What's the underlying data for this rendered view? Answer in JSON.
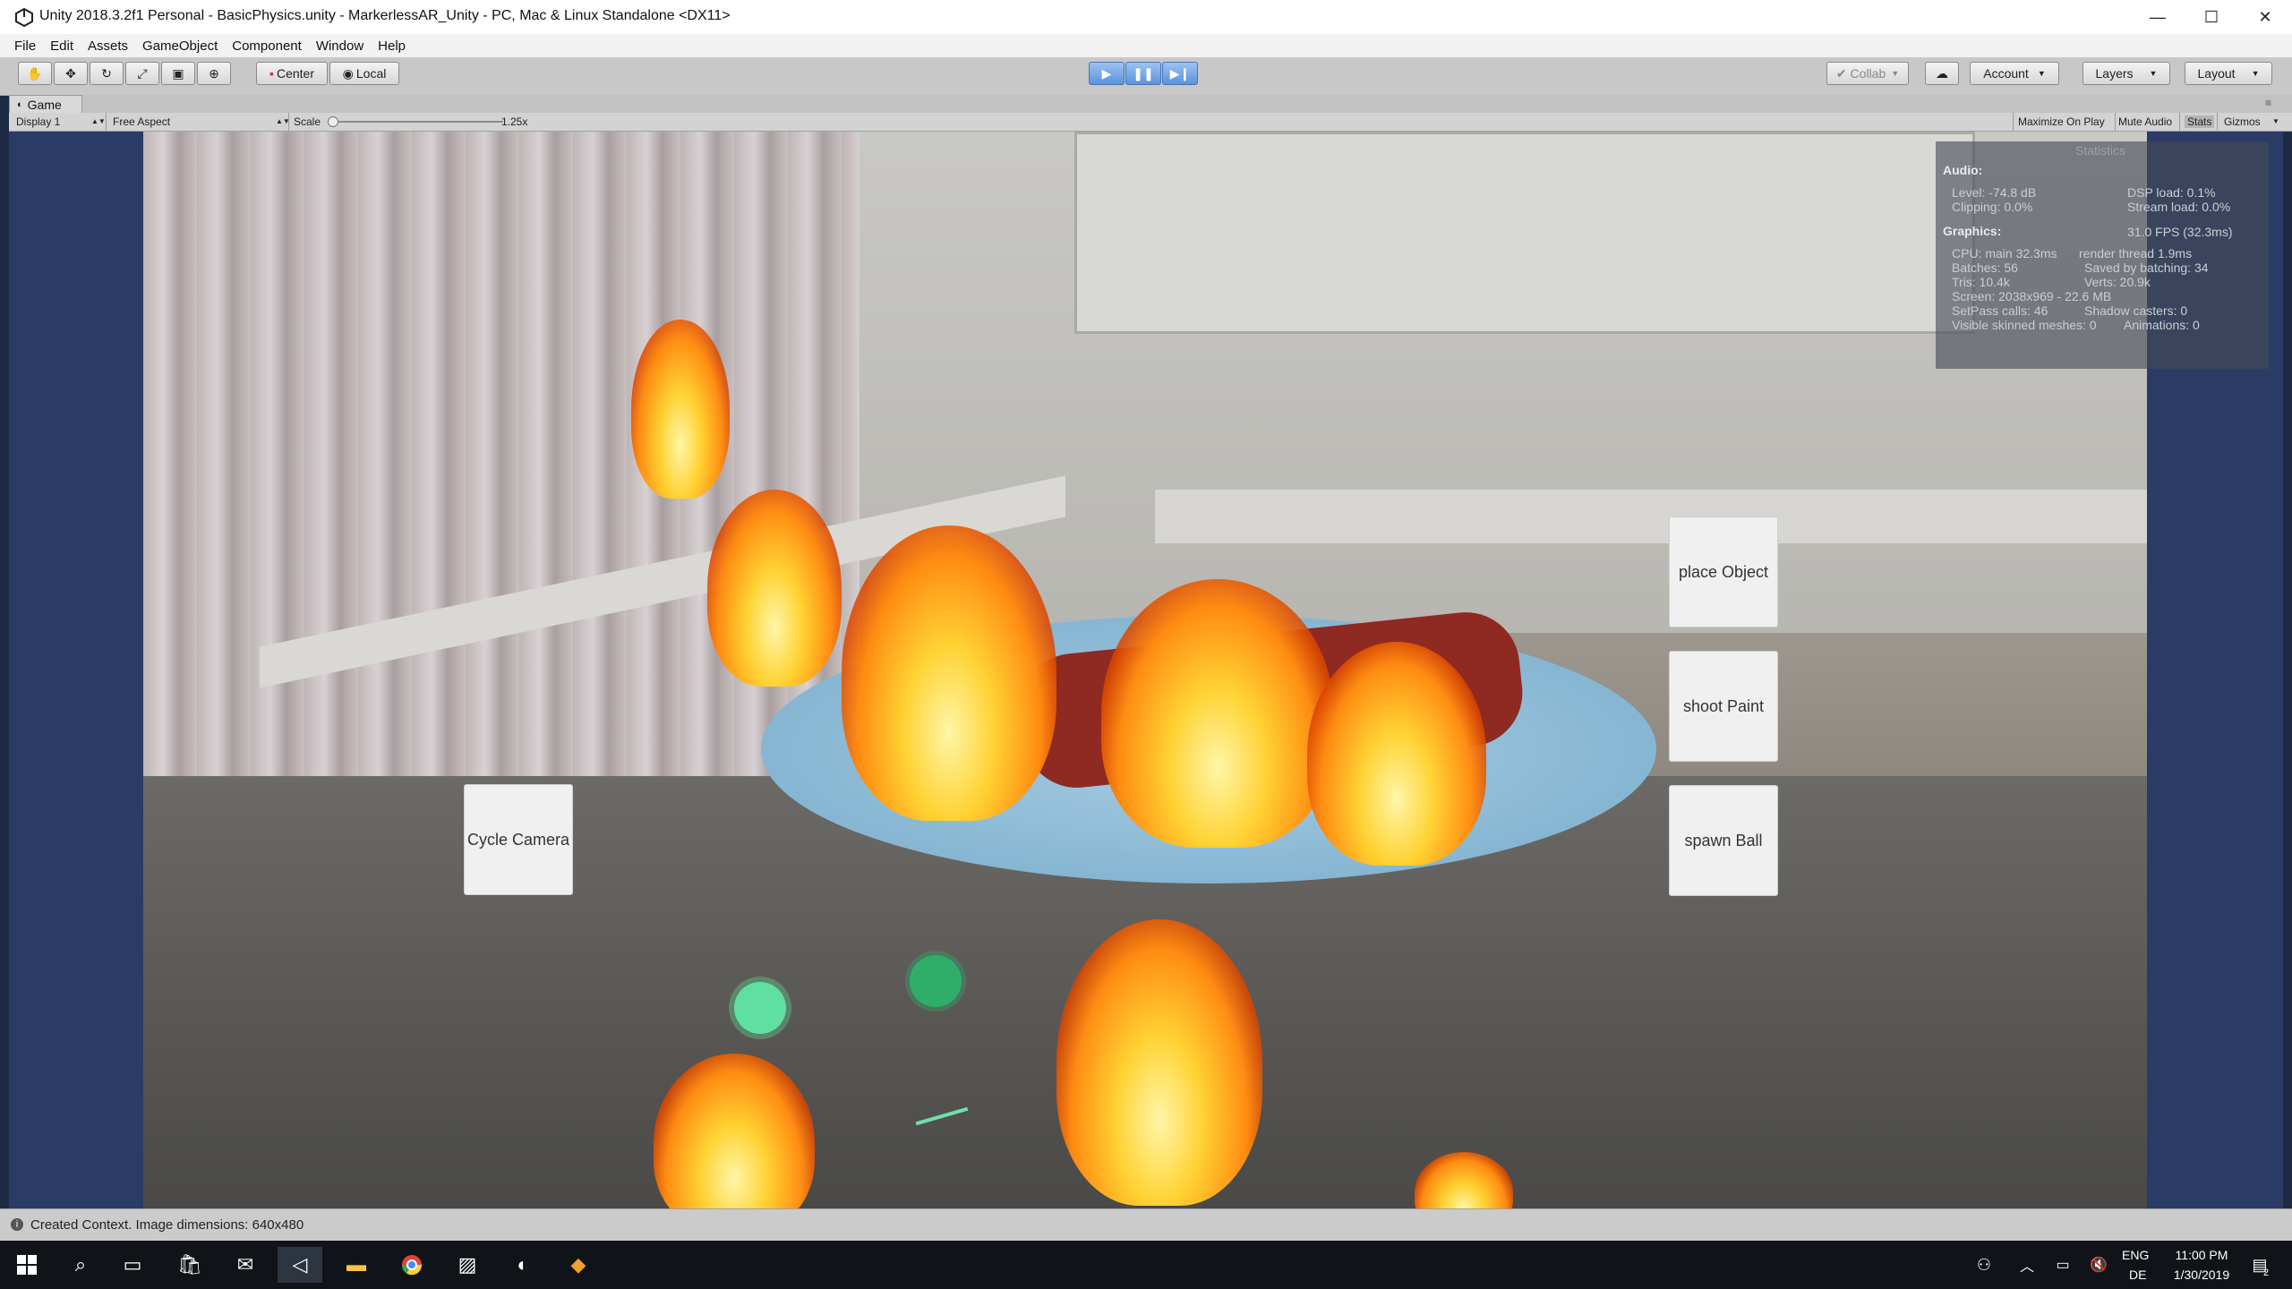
{
  "window": {
    "title": "Unity 2018.3.2f1 Personal - BasicPhysics.unity - MarkerlessAR_Unity - PC, Mac & Linux Standalone <DX11>",
    "minimize": "—",
    "maximize": "☐",
    "close": "✕"
  },
  "menu": [
    "File",
    "Edit",
    "Assets",
    "GameObject",
    "Component",
    "Window",
    "Help"
  ],
  "toolbar": {
    "center_label": "Center",
    "local_label": "Local",
    "collab_label": "Collab",
    "account_label": "Account",
    "layers_label": "Layers",
    "layout_label": "Layout"
  },
  "game_tab": {
    "title": "Game",
    "display": "Display 1",
    "aspect": "Free Aspect",
    "scale_label": "Scale",
    "scale_value": "1.25x",
    "maximize_on_play": "Maximize On Play",
    "mute_audio": "Mute Audio",
    "stats": "Stats",
    "gizmos": "Gizmos"
  },
  "game_buttons": {
    "cycle_camera": "Cycle Camera",
    "place_object": "place Object",
    "shoot_paint": "shoot Paint",
    "spawn_ball": "spawn Ball"
  },
  "statistics": {
    "title": "Statistics",
    "audio_heading": "Audio:",
    "level": "Level: -74.8 dB",
    "clipping": "Clipping: 0.0%",
    "dsp_load": "DSP load: 0.1%",
    "stream_load": "Stream load: 0.0%",
    "graphics_heading": "Graphics:",
    "fps": "31.0 FPS (32.3ms)",
    "cpu_main": "CPU: main 32.3ms",
    "render_thread": "render thread 1.9ms",
    "batches": "Batches: 56",
    "saved_by_batching": "Saved by batching: 34",
    "tris": "Tris: 10.4k",
    "verts": "Verts: 20.9k",
    "screen": "Screen: 2038x969 - 22.6 MB",
    "setpass": "SetPass calls: 46",
    "shadow_casters": "Shadow casters: 0",
    "visible_skinned": "Visible skinned meshes: 0",
    "animations": "Animations: 0"
  },
  "status_bar": {
    "message": "Created Context. Image dimensions: 640x480"
  },
  "taskbar": {
    "lang_top": "ENG",
    "lang_bottom": "DE",
    "time": "11:00 PM",
    "date": "1/30/2019",
    "notification_count": "2"
  },
  "colors": {
    "play_active": "#5b93dd",
    "game_background": "#2a3b66",
    "paint_splat": "#4ed58a"
  }
}
